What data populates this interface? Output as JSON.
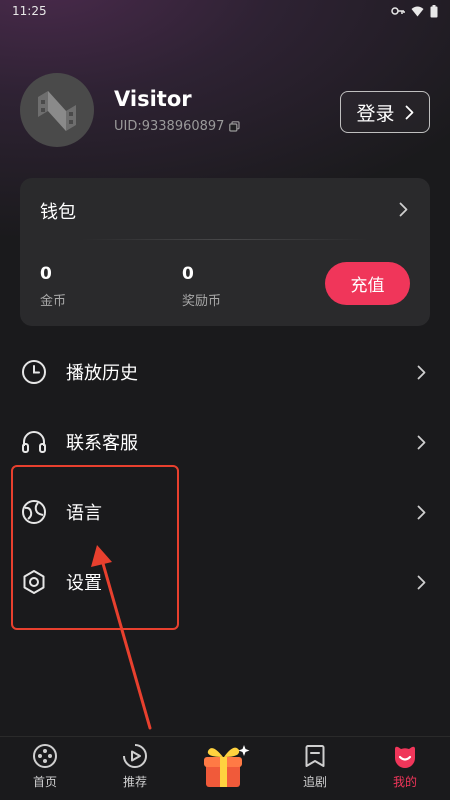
{
  "status_bar": {
    "time": "11:25"
  },
  "profile": {
    "username": "Visitor",
    "uid": "UID:9338960897",
    "login_label": "登录"
  },
  "wallet": {
    "title": "钱包",
    "coins_value": "0",
    "coins_label": "金币",
    "bonus_value": "0",
    "bonus_label": "奖励币",
    "recharge_label": "充值"
  },
  "menu": {
    "items": [
      {
        "label": "播放历史",
        "icon": "clock-icon"
      },
      {
        "label": "联系客服",
        "icon": "headphones-icon"
      },
      {
        "label": "语言",
        "icon": "globe-icon"
      },
      {
        "label": "设置",
        "icon": "hexagon-gear-icon"
      }
    ]
  },
  "bottom_nav": {
    "items": [
      {
        "label": "首页",
        "icon": "film-reel-icon"
      },
      {
        "label": "推荐",
        "icon": "play-circle-icon"
      },
      {
        "label": "",
        "icon": "gift-box-icon"
      },
      {
        "label": "追剧",
        "icon": "bookmark-icon"
      },
      {
        "label": "我的",
        "icon": "smile-face-icon",
        "active": true
      }
    ]
  },
  "colors": {
    "accent": "#f0365a",
    "background": "#1a1a1c",
    "card": "#2a2a2c",
    "annotation": "#e8402e"
  }
}
